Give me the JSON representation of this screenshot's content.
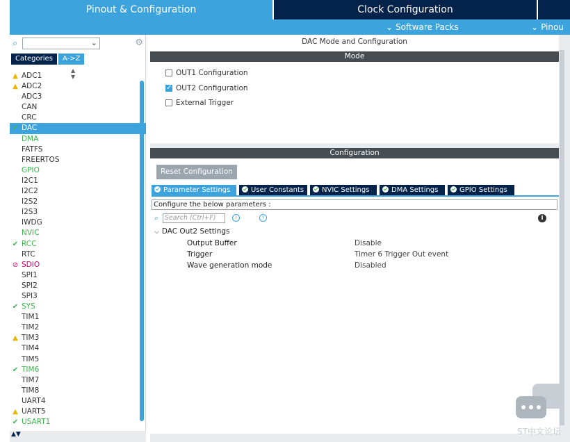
{
  "top_tabs": {
    "pinout": "Pinout & Configuration",
    "clock": "Clock Configuration"
  },
  "sub_bar": {
    "software_packs": "Software Packs",
    "pinout": "Pinou"
  },
  "left": {
    "search_placeholder": "",
    "categories_tab": "Categories",
    "az_tab": "A->Z",
    "items": [
      {
        "label": "ADC1",
        "mark": "warn",
        "style": "normal"
      },
      {
        "label": "ADC2",
        "mark": "warn",
        "style": "normal"
      },
      {
        "label": "ADC3",
        "mark": "",
        "style": "normal"
      },
      {
        "label": "CAN",
        "mark": "",
        "style": "normal"
      },
      {
        "label": "CRC",
        "mark": "",
        "style": "normal"
      },
      {
        "label": "DAC",
        "mark": "ok",
        "style": "selected"
      },
      {
        "label": "DMA",
        "mark": "",
        "style": "green"
      },
      {
        "label": "FATFS",
        "mark": "",
        "style": "normal"
      },
      {
        "label": "FREERTOS",
        "mark": "",
        "style": "normal"
      },
      {
        "label": "GPIO",
        "mark": "",
        "style": "green"
      },
      {
        "label": "I2C1",
        "mark": "",
        "style": "normal"
      },
      {
        "label": "I2C2",
        "mark": "",
        "style": "normal"
      },
      {
        "label": "I2S2",
        "mark": "",
        "style": "normal"
      },
      {
        "label": "I2S3",
        "mark": "",
        "style": "normal"
      },
      {
        "label": "IWDG",
        "mark": "",
        "style": "normal"
      },
      {
        "label": "NVIC",
        "mark": "",
        "style": "green"
      },
      {
        "label": "RCC",
        "mark": "ok",
        "style": "green"
      },
      {
        "label": "RTC",
        "mark": "",
        "style": "normal"
      },
      {
        "label": "SDIO",
        "mark": "no",
        "style": "magenta"
      },
      {
        "label": "SPI1",
        "mark": "",
        "style": "normal"
      },
      {
        "label": "SPI2",
        "mark": "",
        "style": "normal"
      },
      {
        "label": "SPI3",
        "mark": "",
        "style": "normal"
      },
      {
        "label": "SYS",
        "mark": "ok",
        "style": "green"
      },
      {
        "label": "TIM1",
        "mark": "",
        "style": "normal"
      },
      {
        "label": "TIM2",
        "mark": "",
        "style": "normal"
      },
      {
        "label": "TIM3",
        "mark": "warn",
        "style": "normal"
      },
      {
        "label": "TIM4",
        "mark": "",
        "style": "normal"
      },
      {
        "label": "TIM5",
        "mark": "",
        "style": "normal"
      },
      {
        "label": "TIM6",
        "mark": "ok",
        "style": "green"
      },
      {
        "label": "TIM7",
        "mark": "",
        "style": "normal"
      },
      {
        "label": "TIM8",
        "mark": "",
        "style": "normal"
      },
      {
        "label": "UART4",
        "mark": "",
        "style": "normal"
      },
      {
        "label": "UART5",
        "mark": "warn",
        "style": "normal"
      },
      {
        "label": "USART1",
        "mark": "ok",
        "style": "green"
      }
    ]
  },
  "main": {
    "title": "DAC Mode and Configuration",
    "mode_band": "Mode",
    "checkboxes": [
      {
        "label": "OUT1 Configuration",
        "checked": false
      },
      {
        "label": "OUT2 Configuration",
        "checked": true
      },
      {
        "label": "External Trigger",
        "checked": false
      }
    ],
    "config_band": "Configuration",
    "reset_button": "Reset Configuration",
    "tabs": [
      {
        "label": "Parameter Settings",
        "active": true
      },
      {
        "label": "User Constants",
        "active": false
      },
      {
        "label": "NVIC Settings",
        "active": false
      },
      {
        "label": "DMA Settings",
        "active": false
      },
      {
        "label": "GPIO Settings",
        "active": false
      }
    ],
    "hint": "Configure the below parameters :",
    "search_placeholder": "Search (Ctrl+F)",
    "group_label": "DAC Out2 Settings",
    "params": [
      {
        "name": "Output Buffer",
        "value": "Disable"
      },
      {
        "name": "Trigger",
        "value": "Timer 6 Trigger Out event"
      },
      {
        "name": "Wave generation mode",
        "value": "Disabled"
      }
    ]
  },
  "watermark": "ST中文论坛",
  "colors": {
    "accent": "#3ca3dc",
    "navy": "#03234b",
    "band": "#454c52",
    "ok": "#3cb44b",
    "warn": "#e8b400",
    "error": "#d6006a"
  }
}
